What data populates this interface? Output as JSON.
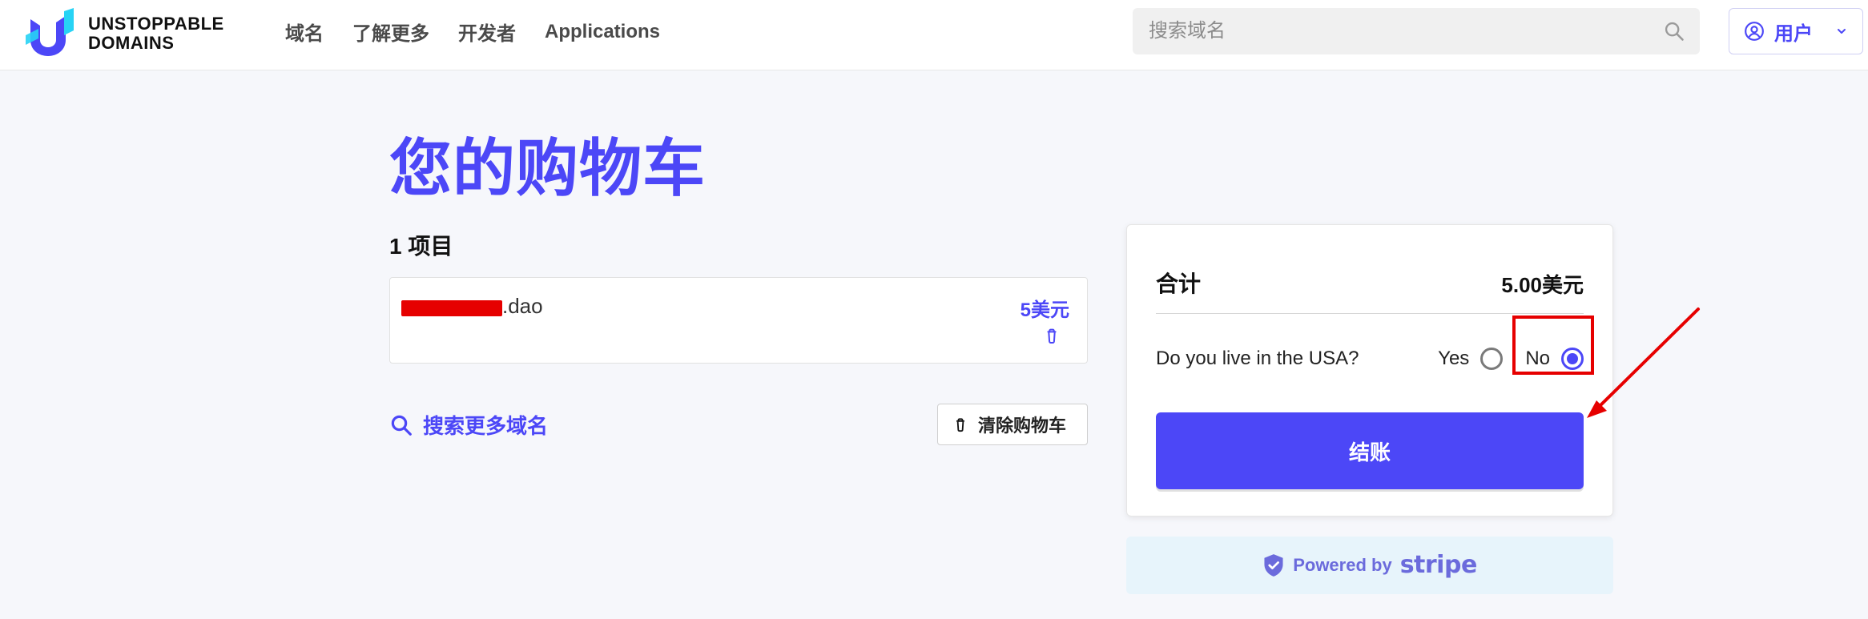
{
  "colors": {
    "accent": "#4c47f7",
    "annotation_red": "#e60000",
    "redaction_red": "#e60000"
  },
  "header": {
    "brand_line1": "UNSTOPPABLE",
    "brand_line2": "DOMAINS",
    "nav": [
      {
        "label": "域名"
      },
      {
        "label": "了解更多"
      },
      {
        "label": "开发者"
      },
      {
        "label": "Applications"
      }
    ],
    "search": {
      "placeholder": "搜索域名",
      "value": ""
    },
    "user_label": "用户",
    "icons": {
      "search": "search-icon",
      "user": "user-circle-icon",
      "chevron": "chevron-down-icon"
    }
  },
  "page": {
    "title": "您的购物车",
    "items_count_label": "1 项目"
  },
  "cart": {
    "items": [
      {
        "name_suffix": ".dao",
        "price": "5美元"
      }
    ],
    "search_more_label": "搜索更多域名",
    "clear_cart_label": "清除购物车"
  },
  "summary": {
    "total_label": "合计",
    "total_value": "5.00美元",
    "question": "Do you live in the USA?",
    "yes_label": "Yes",
    "no_label": "No",
    "selected": "No",
    "checkout_label": "结账"
  },
  "stripe": {
    "powered_by": "Powered by",
    "brand": "stripe"
  }
}
